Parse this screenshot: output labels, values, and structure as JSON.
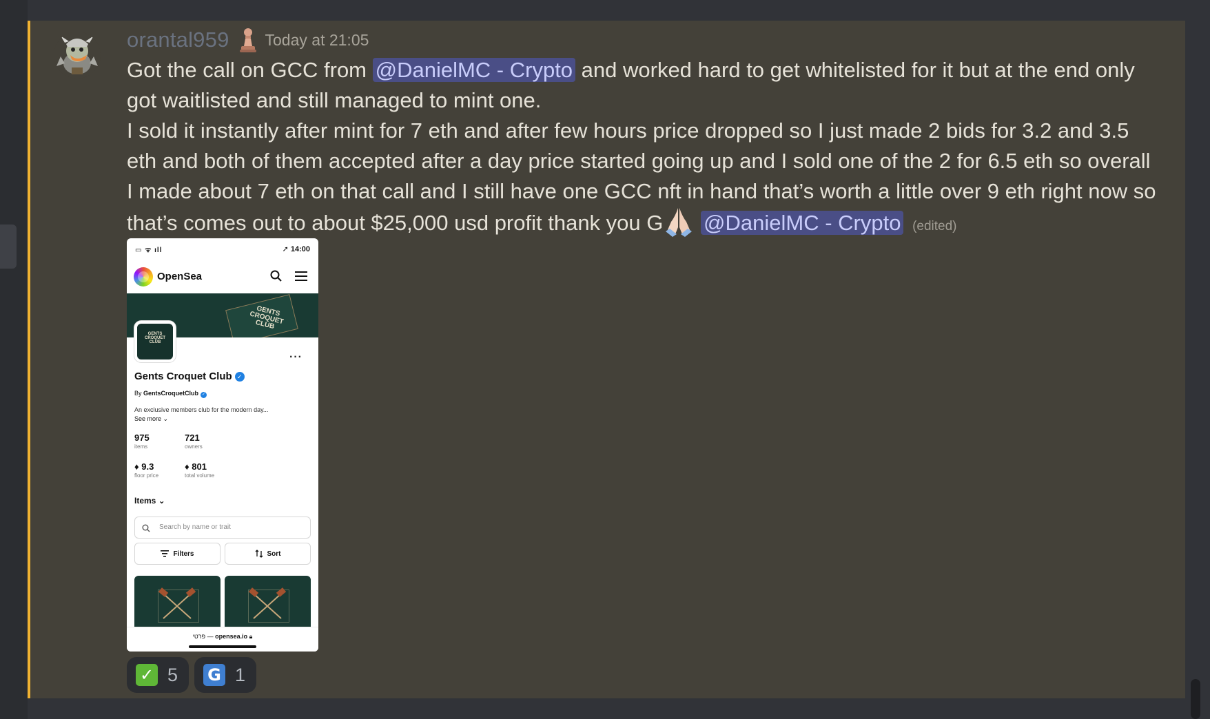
{
  "message": {
    "username": "orantal959",
    "timestamp": "Today at 21:05",
    "text_part1": "Got the call on GCC from ",
    "mention1": "@DanielMC - Crypto",
    "text_part2": " and worked hard to get whitelisted for it but at the end only got waitlisted and still managed to mint one.",
    "text_part3": "I sold it instantly after mint for 7 eth and after few hours price dropped so I just made 2 bids for 3.2 and 3.5 eth and both of them accepted after a day price started going up and I sold one of the 2 for 6.5 eth so overall I made about 7 eth on that call and I still have one GCC nft in hand that’s worth a little over 9 eth right now so that’s comes out to about $25,000 usd profit thank you G",
    "mention2": "@DanielMC - Crypto",
    "edited": "(edited)",
    "accent_color": "#f0b232"
  },
  "attachment": {
    "status_time": "14:00",
    "app_name": "OpenSea",
    "banner_text": "GENTS CROQUET CLUB",
    "collection_name": "Gents Croquet Club",
    "by_prefix": "By ",
    "by_name": "GentsCroquetClub",
    "description": "An exclusive members club for the modern day...",
    "see_more": "See more ⌄",
    "stats": [
      {
        "value": "975",
        "label": "items"
      },
      {
        "value": "721",
        "label": "owners"
      },
      {
        "value": "♦ 9.3",
        "label": "floor price"
      },
      {
        "value": "♦ 801",
        "label": "total volume"
      }
    ],
    "items_heading": "Items ⌄",
    "search_placeholder": "Search by name or trait",
    "filters_label": "Filters",
    "sort_label": "Sort",
    "url_prefix": "פרטי — ",
    "url": "opensea.io"
  },
  "reactions": [
    {
      "emoji": "✓",
      "icon": "check-mark-icon",
      "count": "5",
      "color": "#5fb737"
    },
    {
      "emoji": "G",
      "icon": "g-letter-icon",
      "count": "1",
      "color": "#3f7fd1"
    }
  ]
}
